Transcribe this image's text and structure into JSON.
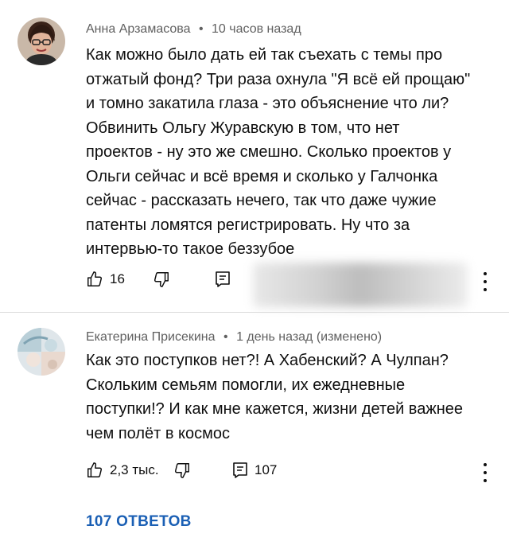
{
  "comments": [
    {
      "author": "Анна Арзамасова",
      "time": "10 часов назад",
      "text": "Как можно было дать ей так съехать с темы про\nотжатый фонд? Три раза охнула \"Я всё ей прощаю\"\nи томно закатила глаза - это объяснение что ли?\nОбвинить Ольгу Журавскую в том, что нет\nпроектов - ну это же смешно. Сколько проектов у\nОльги сейчас и всё время и сколько у Галчонка\nсейчас - рассказать нечего, так что даже чужие\nпатенты ломятся регистрировать. Ну что за\nинтервью-то такое беззубое",
      "likes": "16",
      "reply_count": ""
    },
    {
      "author": "Екатерина Присекина",
      "time": "1 день назад (изменено)",
      "text": "Как это поступков нет?! А Хабенский? А Чулпан?\nСкольким семьям  помогли, их ежедневные\nпоступки!? И как мне кажется, жизни детей важнее\nчем полёт в космос",
      "likes": "2,3 тыс.",
      "reply_count": "107"
    }
  ],
  "replies_link": "107 ОТВЕТОВ",
  "separator": "•",
  "icons": [
    "thumb-up-icon",
    "thumb-down-icon",
    "reply-comment-icon",
    "more-vert-icon"
  ],
  "colors": {
    "meta": "#606060",
    "link": "#1a5fb4",
    "text": "#0f0f0f"
  }
}
